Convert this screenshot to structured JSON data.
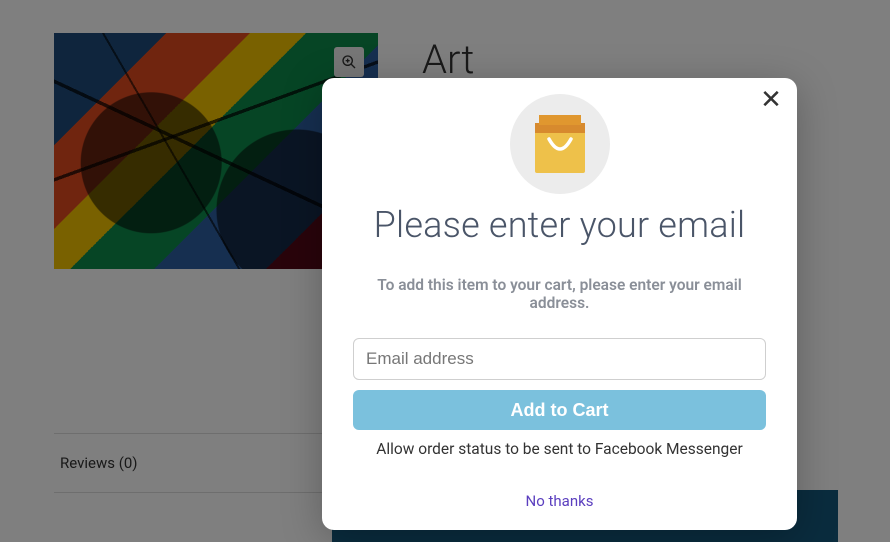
{
  "product": {
    "title": "Art"
  },
  "tabs": {
    "reviews_label": "Reviews (0)"
  },
  "modal": {
    "heading": "Please enter your email",
    "subtext": "To add this item to your cart, please enter your email address.",
    "email_placeholder": "Email address",
    "email_value": "",
    "add_to_cart_label": "Add to Cart",
    "fb_text": "Allow order status to be sent to Facebook Messenger",
    "no_thanks_label": "No thanks"
  },
  "icons": {
    "zoom": "zoom-in-icon",
    "chevron": "chevron-right-icon",
    "close": "close-icon",
    "bag": "shopping-bag-icon"
  },
  "colors": {
    "modal_button": "#7bc1dd",
    "no_thanks": "#5b3fbf",
    "blue_box": "#15597c"
  }
}
